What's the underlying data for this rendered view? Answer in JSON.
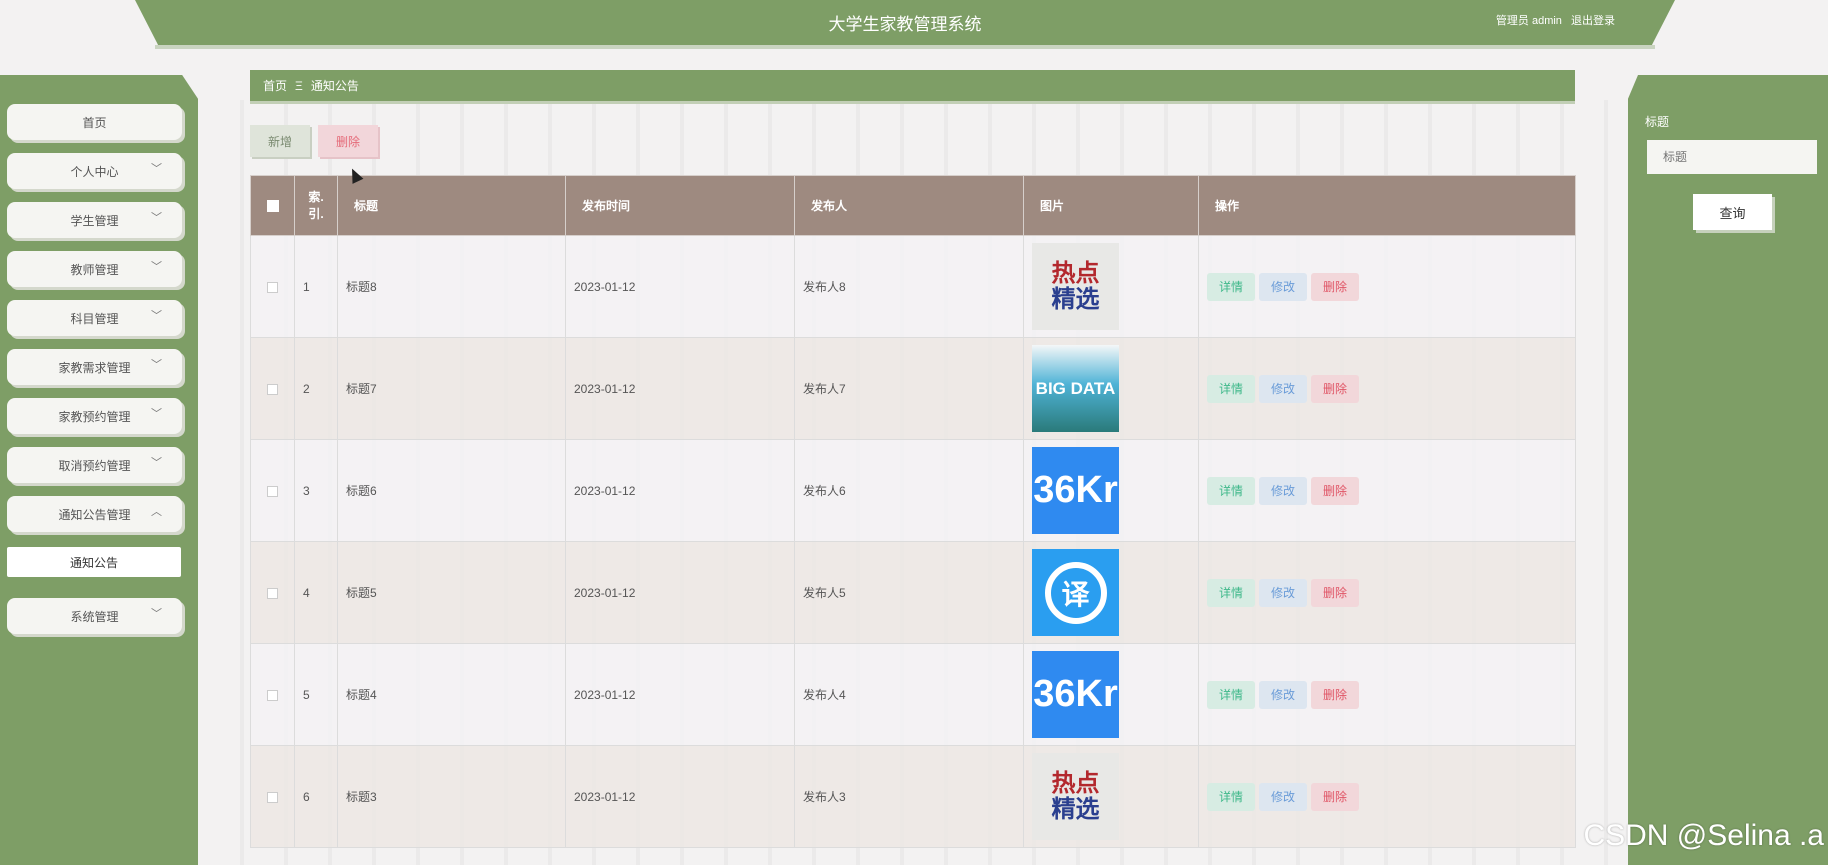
{
  "header": {
    "title": "大学生家教管理系统",
    "user_label": "管理员 admin",
    "logout": "退出登录"
  },
  "sidebar": {
    "items": [
      {
        "label": "首页",
        "has_chevron": false
      },
      {
        "label": "个人中心",
        "has_chevron": true
      },
      {
        "label": "学生管理",
        "has_chevron": true
      },
      {
        "label": "教师管理",
        "has_chevron": true
      },
      {
        "label": "科目管理",
        "has_chevron": true
      },
      {
        "label": "家教需求管理",
        "has_chevron": true
      },
      {
        "label": "家教预约管理",
        "has_chevron": true
      },
      {
        "label": "取消预约管理",
        "has_chevron": true
      },
      {
        "label": "通知公告管理",
        "has_chevron": true,
        "expanded": true
      },
      {
        "label": "系统管理",
        "has_chevron": true
      }
    ],
    "sub_item": "通知公告"
  },
  "breadcrumb": {
    "home": "首页",
    "separator": "Ξ",
    "current": "通知公告"
  },
  "toolbar": {
    "add": "新增",
    "delete": "删除"
  },
  "search": {
    "label": "标题",
    "placeholder": "标题",
    "button": "查询"
  },
  "table": {
    "headers": {
      "index": "索引",
      "title": "标题",
      "time": "发布时间",
      "author": "发布人",
      "image": "图片",
      "actions": "操作"
    },
    "actions": {
      "detail": "详情",
      "edit": "修改",
      "delete": "删除"
    },
    "rows": [
      {
        "index": "1",
        "title": "标题8",
        "time": "2023-01-12",
        "author": "发布人8",
        "image": "hot-pick"
      },
      {
        "index": "2",
        "title": "标题7",
        "time": "2023-01-12",
        "author": "发布人7",
        "image": "big-data"
      },
      {
        "index": "3",
        "title": "标题6",
        "time": "2023-01-12",
        "author": "发布人6",
        "image": "36kr"
      },
      {
        "index": "4",
        "title": "标题5",
        "time": "2023-01-12",
        "author": "发布人5",
        "image": "translate"
      },
      {
        "index": "5",
        "title": "标题4",
        "time": "2023-01-12",
        "author": "发布人4",
        "image": "36kr"
      },
      {
        "index": "6",
        "title": "标题3",
        "time": "2023-01-12",
        "author": "发布人3",
        "image": "hot-pick"
      }
    ],
    "image_text": {
      "hot_1": "热点",
      "hot_2": "精选",
      "big": "BIG DATA",
      "kr": "36Kr",
      "yi": "译"
    }
  },
  "watermark": "CSDN @Selina .a"
}
